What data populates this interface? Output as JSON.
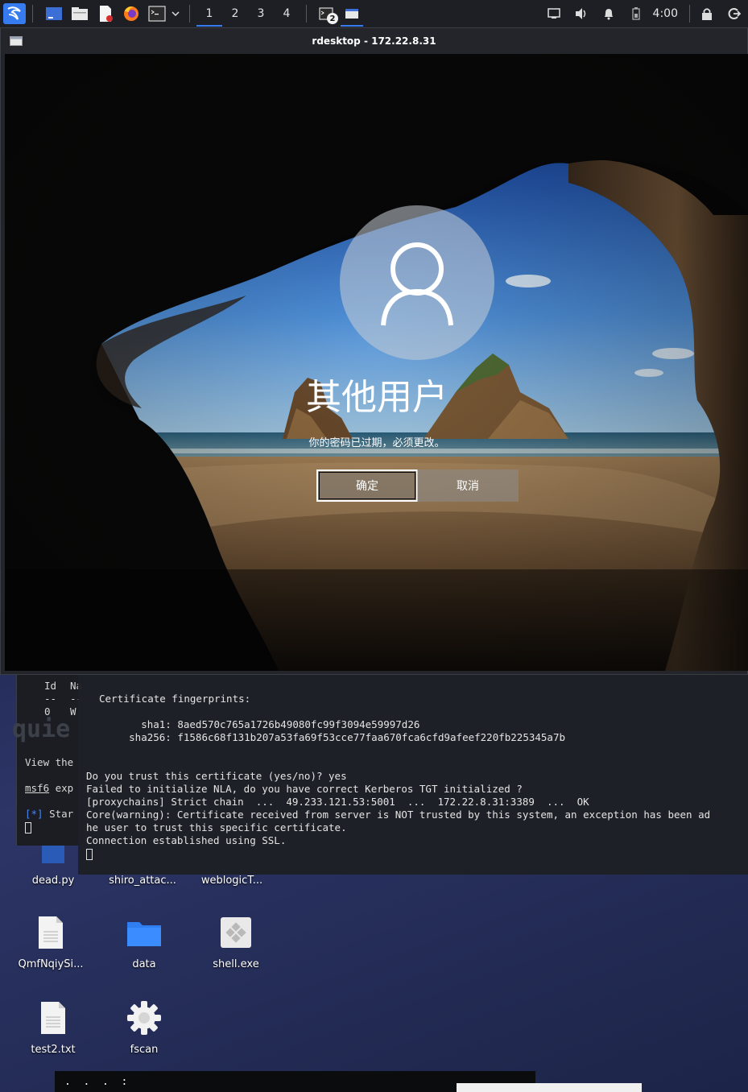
{
  "taskbar": {
    "workspaces": [
      "1",
      "2",
      "3",
      "4"
    ],
    "active_workspace": "1",
    "terminal_badge": "2",
    "clock": "4:00",
    "accent": "#367bf0"
  },
  "rdesktop": {
    "title": "rdesktop - 172.22.8.31",
    "lock_screen": {
      "user": "其他用户",
      "message": "你的密码已过期，必须更改。",
      "ok_button": "确定",
      "cancel_button": "取消"
    }
  },
  "bg_terminal": {
    "header_id": "Id",
    "header_name": "Na",
    "dash1": "--",
    "dash2": "--",
    "row_id": "0",
    "row_name": "W",
    "big_text": "quie",
    "view_line": "View the",
    "msf_link": "msf6",
    "msf_rest": " exp",
    "status_tag": "[*]",
    "status_text": " Star"
  },
  "fg_terminal": {
    "lines": [
      "Certificate fingerprints:",
      "",
      "        sha1: 8aed570c765a1726b49080fc99f3094e59997d26",
      "      sha256: f1586c68f131b207a53fa69f53cce77faa670fca6cfd9afeef220fb225345a7b",
      "",
      "Do you trust this certificate (yes/no)? yes",
      "Failed to initialize NLA, do you have correct Kerberos TGT initialized ?",
      "[proxychains] Strict chain  ...  49.233.121.53:5001  ...  172.22.8.31:3389  ...  OK",
      "Core(warning): Certificate received from server is NOT trusted by this system, an exception has been ad",
      "he user to trust this specific certificate.",
      "Connection established using SSL."
    ]
  },
  "desktop_icons": [
    {
      "label": "dead.py",
      "icon": "python-file-icon"
    },
    {
      "label": "shiro_attac...",
      "icon": "folder-icon"
    },
    {
      "label": "weblogicT...",
      "icon": "folder-icon"
    },
    {
      "label": "QmfNqiySi...",
      "icon": "text-file-icon"
    },
    {
      "label": "data",
      "icon": "folder-icon"
    },
    {
      "label": "shell.exe",
      "icon": "exe-file-icon"
    },
    {
      "label": "test2.txt",
      "icon": "text-file-icon"
    },
    {
      "label": "fscan",
      "icon": "gear-icon"
    }
  ],
  "bottom_window": {
    "text": ".  .  .  :"
  }
}
